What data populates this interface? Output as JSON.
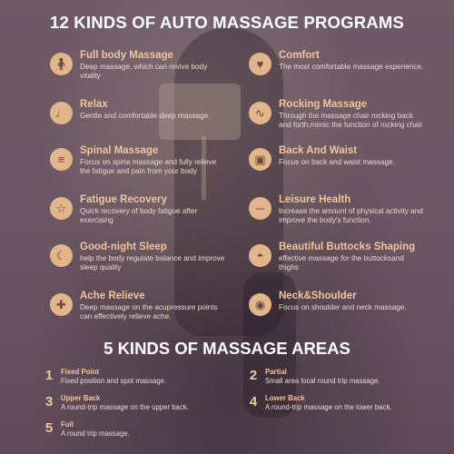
{
  "heading_programs": "12  KINDS OF AUTO MASSAGE PROGRAMS",
  "heading_areas": "5 KINDS OF MASSAGE AREAS",
  "programs": [
    {
      "title": "Full body Massage",
      "desc": "Deep massage, which can revive body vitality",
      "icon": "person-standing-icon"
    },
    {
      "title": "Comfort",
      "desc": "The most comfortable massage experience.",
      "icon": "seated-person-icon"
    },
    {
      "title": "Relax",
      "desc": "Gentle and comfortable deep massage.",
      "icon": "reclining-person-icon"
    },
    {
      "title": "Rocking Massage",
      "desc": "Through the massage chair rocking back and forth,mimic the function of rocking chair",
      "icon": "rocking-chair-icon"
    },
    {
      "title": "Spinal Massage",
      "desc": "Focus on spine massage and fully relieve the fatigue and pain from your body",
      "icon": "spine-icon"
    },
    {
      "title": "Back And Waist",
      "desc": "Focus on back and waist massage.",
      "icon": "back-waist-icon"
    },
    {
      "title": "Fatigue Recovery",
      "desc": "Quick recovery of body fatigue after exercising",
      "icon": "stretching-person-icon"
    },
    {
      "title": "Leisure Health",
      "desc": "Increase the amount of physical activity and improve the body's function.",
      "icon": "lying-person-icon"
    },
    {
      "title": "Good-night Sleep",
      "desc": "help the body regulate balance and improve sleep quality",
      "icon": "moon-icon"
    },
    {
      "title": "Beautiful Buttocks Shaping",
      "desc": "effective massage for the buttocksand thighs",
      "icon": "buttocks-icon"
    },
    {
      "title": "Ache Relieve",
      "desc": "Deep massage on the acupressure points can effectively relieve ache.",
      "icon": "acupressure-icon"
    },
    {
      "title": "Neck&Shoulder",
      "desc": "Focus on shoulder and neck massage.",
      "icon": "neck-shoulder-icon"
    }
  ],
  "areas": [
    {
      "num": "1",
      "title": "Fixed Point",
      "desc": "Fixed position and spot massage."
    },
    {
      "num": "2",
      "title": "Partial",
      "desc": "Small area local round trip massage."
    },
    {
      "num": "3",
      "title": "Upper Back",
      "desc": "A round-trip massage on the upper back."
    },
    {
      "num": "4",
      "title": "Lower Back",
      "desc": "A round-trip massage on the lower back."
    },
    {
      "num": "5",
      "title": "Full",
      "desc": "A round trip massage."
    }
  ],
  "colors": {
    "accent": "#f0c59c",
    "icon_bg": "#e2b58a",
    "background": "#6a5662",
    "text": "#e8d9d0"
  }
}
